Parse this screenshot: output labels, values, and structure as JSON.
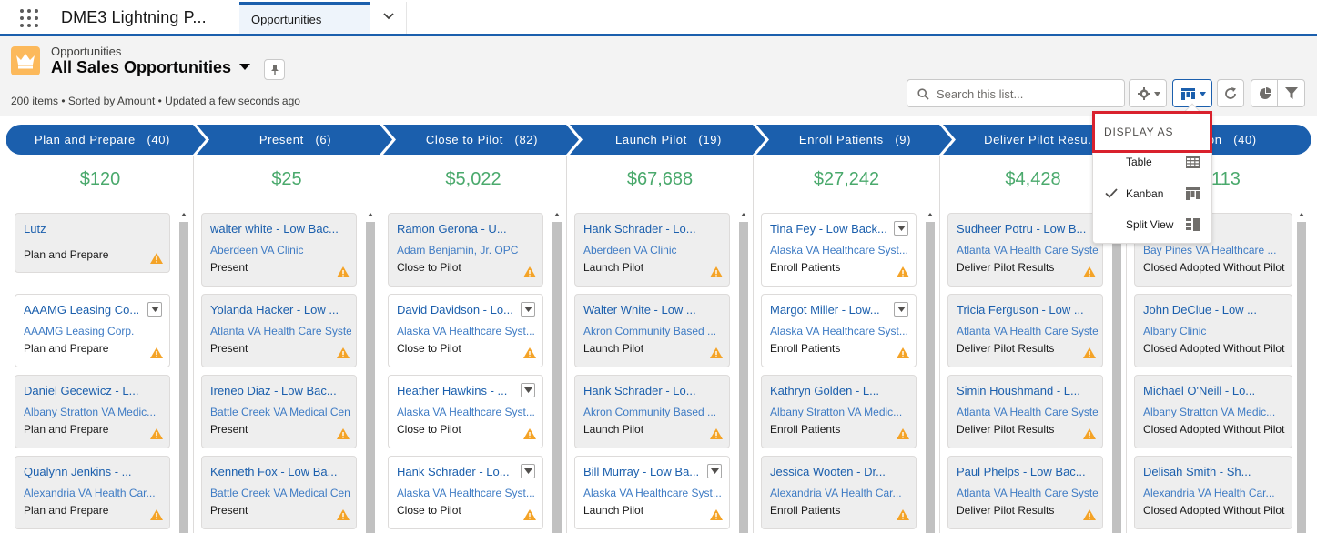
{
  "nav": {
    "app_name": "DME3 Lightning P...",
    "tab_label": "Opportunities"
  },
  "header": {
    "object_label": "Opportunities",
    "list_name": "All Sales Opportunities",
    "meta": "200 items • Sorted by Amount • Updated a few seconds ago",
    "search_placeholder": "Search this list..."
  },
  "stages": [
    {
      "label": "Plan and Prepare",
      "count": "(40)"
    },
    {
      "label": "Present",
      "count": "(6)"
    },
    {
      "label": "Close to Pilot",
      "count": "(82)"
    },
    {
      "label": "Launch Pilot",
      "count": "(19)"
    },
    {
      "label": "Enroll Patients",
      "count": "(9)"
    },
    {
      "label": "Deliver Pilot Resu...",
      "count": ""
    },
    {
      "label": "Won",
      "count": "(40)"
    }
  ],
  "columns": [
    {
      "total": "$120",
      "cards": [
        {
          "title": "Lutz",
          "account": "",
          "stage": "Plan and Prepare"
        },
        {
          "title": "AAAMG Leasing Co...",
          "account": "AAAMG Leasing Corp.",
          "stage": "Plan and Prepare"
        },
        {
          "title": "Daniel Gecewicz - L...",
          "account": "Albany Stratton VA Medic...",
          "stage": "Plan and Prepare"
        },
        {
          "title": "Qualynn Jenkins - ...",
          "account": "Alexandria VA Health Car...",
          "stage": "Plan and Prepare"
        }
      ]
    },
    {
      "total": "$25",
      "cards": [
        {
          "title": "walter white - Low Bac...",
          "account": "Aberdeen VA Clinic",
          "stage": "Present"
        },
        {
          "title": "Yolanda Hacker - Low ...",
          "account": "Atlanta VA Health Care Syste...",
          "stage": "Present"
        },
        {
          "title": "Ireneo Diaz - Low Bac...",
          "account": "Battle Creek VA Medical Cen...",
          "stage": "Present"
        },
        {
          "title": "Kenneth Fox - Low Ba...",
          "account": "Battle Creek VA Medical Cen...",
          "stage": "Present"
        }
      ]
    },
    {
      "total": "$5,022",
      "cards": [
        {
          "title": "Ramon Gerona - U...",
          "account": "Adam Benjamin, Jr. OPC",
          "stage": "Close to Pilot"
        },
        {
          "title": "David Davidson - Lo...",
          "account": "Alaska VA Healthcare Syst...",
          "stage": "Close to Pilot"
        },
        {
          "title": "Heather Hawkins - ...",
          "account": "Alaska VA Healthcare Syst...",
          "stage": "Close to Pilot"
        },
        {
          "title": "Hank Schrader - Lo...",
          "account": "Alaska VA Healthcare Syst...",
          "stage": "Close to Pilot"
        }
      ]
    },
    {
      "total": "$67,688",
      "cards": [
        {
          "title": "Hank Schrader - Lo...",
          "account": "Aberdeen VA Clinic",
          "stage": "Launch Pilot"
        },
        {
          "title": "Walter White - Low ...",
          "account": "Akron Community Based ...",
          "stage": "Launch Pilot"
        },
        {
          "title": "Hank Schrader - Lo...",
          "account": "Akron Community Based ...",
          "stage": "Launch Pilot"
        },
        {
          "title": "Bill Murray - Low Ba...",
          "account": "Alaska VA Healthcare Syst...",
          "stage": "Launch Pilot"
        }
      ]
    },
    {
      "total": "$27,242",
      "cards": [
        {
          "title": "Tina Fey - Low Back...",
          "account": "Alaska VA Healthcare Syst...",
          "stage": "Enroll Patients"
        },
        {
          "title": "Margot Miller - Low...",
          "account": "Alaska VA Healthcare Syst...",
          "stage": "Enroll Patients"
        },
        {
          "title": "Kathryn Golden - L...",
          "account": "Albany Stratton VA Medic...",
          "stage": "Enroll Patients"
        },
        {
          "title": "Jessica Wooten - Dr...",
          "account": "Alexandria VA Health Car...",
          "stage": "Enroll Patients"
        }
      ]
    },
    {
      "total": "$4,428",
      "cards": [
        {
          "title": "Sudheer Potru - Low B...",
          "account": "Atlanta VA Health Care Syste...",
          "stage": "Deliver Pilot Results"
        },
        {
          "title": "Tricia Ferguson - Low ...",
          "account": "Atlanta VA Health Care Syste...",
          "stage": "Deliver Pilot Results"
        },
        {
          "title": "Simin Houshmand - L...",
          "account": "Atlanta VA Health Care Syste...",
          "stage": "Deliver Pilot Results"
        },
        {
          "title": "Paul Phelps - Low Bac...",
          "account": "Atlanta VA Health Care Syste...",
          "stage": "Deliver Pilot Results"
        }
      ]
    },
    {
      "total": "113",
      "cards": [
        {
          "title": "Low ...",
          "account": "Bay Pines VA Healthcare ...",
          "stage": "Closed Adopted Without Pilot"
        },
        {
          "title": "John DeClue - Low ...",
          "account": "Albany Clinic",
          "stage": "Closed Adopted Without Pilot"
        },
        {
          "title": "Michael O'Neill - Lo...",
          "account": "Albany Stratton VA Medic...",
          "stage": "Closed Adopted Without Pilot"
        },
        {
          "title": "Delisah Smith - Sh...",
          "account": "Alexandria VA Health Car...",
          "stage": "Closed Adopted Without Pilot"
        }
      ]
    }
  ],
  "display_menu": {
    "header": "DISPLAY AS",
    "items": [
      {
        "label": "Table",
        "icon": "table-icon",
        "checked": false,
        "highlighted": true
      },
      {
        "label": "Kanban",
        "icon": "kanban-icon",
        "checked": true,
        "highlighted": false
      },
      {
        "label": "Split View",
        "icon": "split-view-icon",
        "checked": false,
        "highlighted": false
      }
    ]
  },
  "colors": {
    "brand": "#1b5fad",
    "path": "#1b5fad",
    "total": "#4aa96c",
    "warning": "#f4a327",
    "highlight": "#d9212d"
  }
}
